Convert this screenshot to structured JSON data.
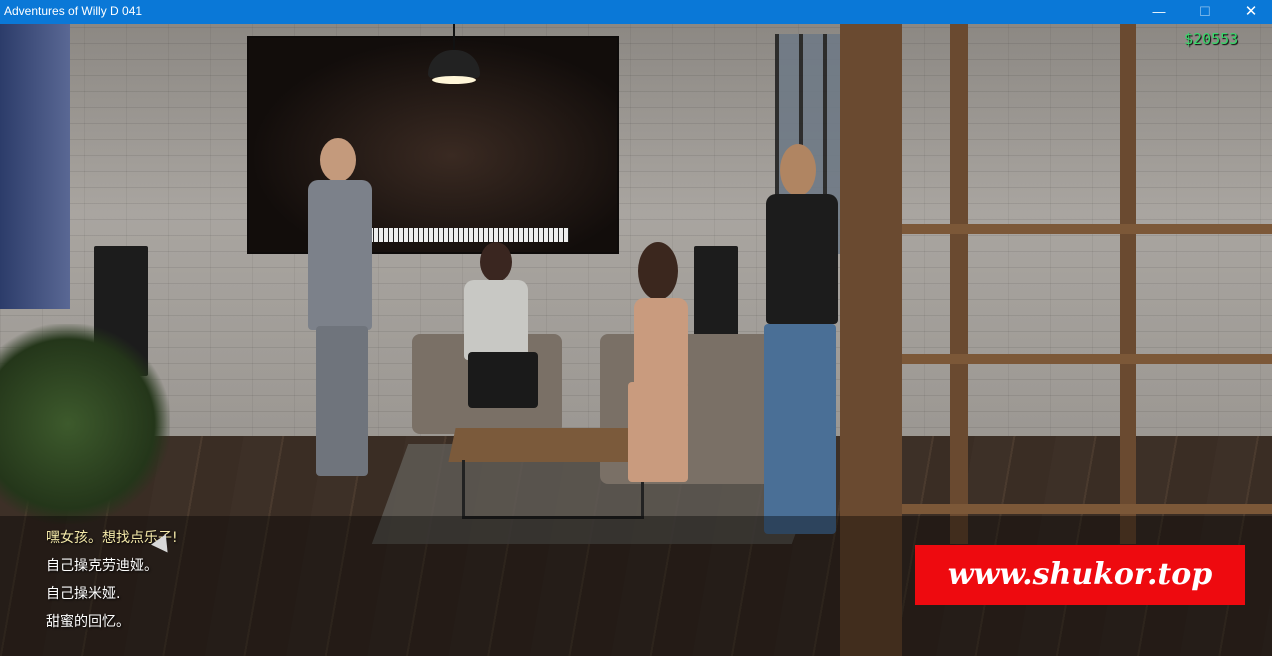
{
  "window": {
    "title": "Adventures of Willy D 041",
    "minimize_glyph": "—",
    "maximize_glyph": "☐",
    "close_glyph": "✕"
  },
  "hud": {
    "money": "$20553",
    "money_color": "#38d86a"
  },
  "dialog": {
    "choices": [
      {
        "label": "嘿女孩。想找点乐子!",
        "state": "hovered"
      },
      {
        "label": "自己操克劳迪娅。"
      },
      {
        "label": "自己操米娅."
      },
      {
        "label": "甜蜜的回忆。"
      }
    ]
  },
  "watermark": {
    "text": "www.shukor.top",
    "background": "#ee0a0f"
  },
  "icons": {
    "cursor": "arrow-cursor-icon"
  },
  "colors": {
    "titlebar": "#0a78d7",
    "choice_hover": "#f3e8a8"
  }
}
